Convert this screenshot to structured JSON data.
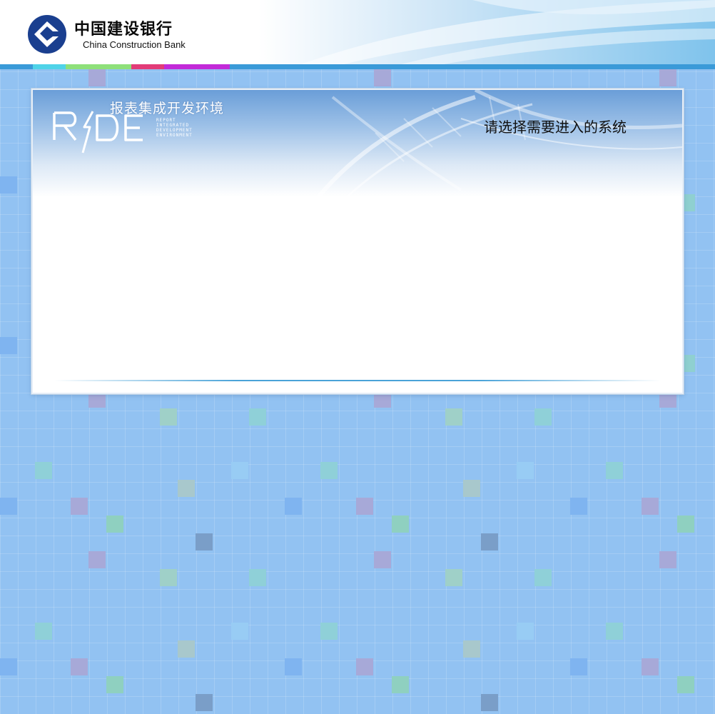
{
  "header": {
    "bank_name_cn": "中国建设银行",
    "bank_name_en": "China Construction Bank",
    "logo_icon": "ccb-logo-icon",
    "strip_colors": [
      "#4fd3e8",
      "#8ee07a",
      "#e23c78",
      "#c22ad8",
      "#3a9ad8"
    ]
  },
  "panel": {
    "brand_icon": "ride-logo-icon",
    "brand_title_cn": "报表集成开发环境",
    "brand_acronym": "RIDE",
    "brand_subtitle_lines": [
      "REPORT",
      "INTEGRATED",
      "DEVELOPMENT",
      "ENVIRONMENT"
    ],
    "prompt": "请选择需要进入的系统"
  },
  "colors": {
    "background": "#92c2f2",
    "logo_blue": "#1a3f8f",
    "panel_accent": "#4aa3d8"
  }
}
